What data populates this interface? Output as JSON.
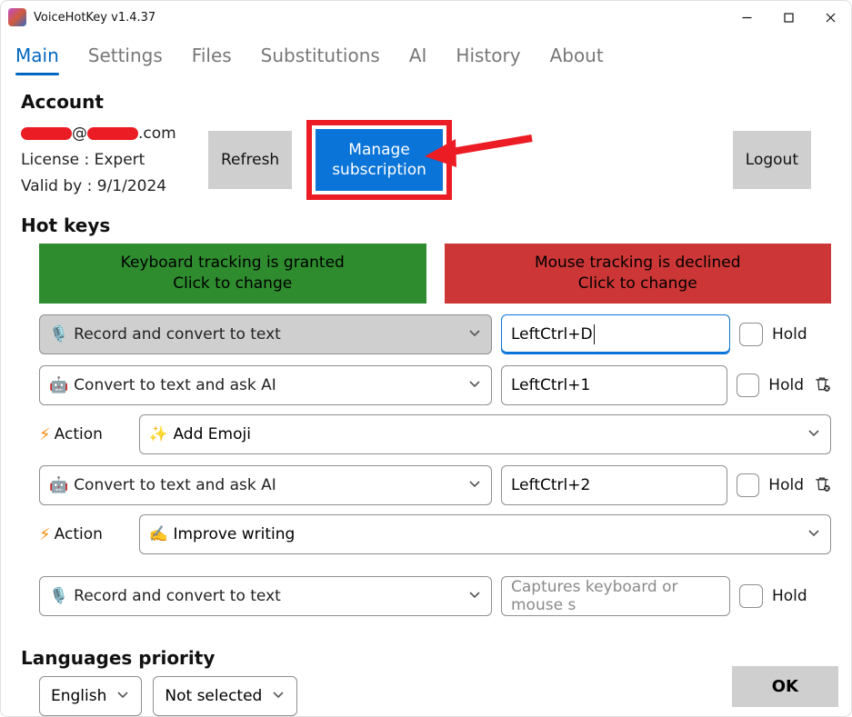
{
  "window": {
    "title": "VoiceHotKey v1.4.37"
  },
  "tabs": [
    {
      "label": "Main",
      "active": true
    },
    {
      "label": "Settings",
      "active": false
    },
    {
      "label": "Files",
      "active": false
    },
    {
      "label": "Substitutions",
      "active": false
    },
    {
      "label": "AI",
      "active": false
    },
    {
      "label": "History",
      "active": false
    },
    {
      "label": "About",
      "active": false
    }
  ],
  "account": {
    "section_title": "Account",
    "email_visible_suffix": ".com",
    "email_at": "@",
    "license_label": "License : Expert",
    "valid_label": "Valid by : 9/1/2024",
    "refresh_label": "Refresh",
    "manage_label_line1": "Manage",
    "manage_label_line2": "subscription",
    "logout_label": "Logout"
  },
  "hotkeys": {
    "section_title": "Hot keys",
    "keyboard_bar_line1": "Keyboard tracking is granted",
    "keyboard_bar_line2": "Click to change",
    "mouse_bar_line1": "Mouse tracking is declined",
    "mouse_bar_line2": "Click to change",
    "rows": [
      {
        "mode_icon": "🎙️",
        "mode_label": "Record and convert to text",
        "mode_grey": true,
        "key_value": "LeftCtrl+D",
        "key_focused": true,
        "hold_label": "Hold",
        "has_delete": false,
        "action": null
      },
      {
        "mode_icon": "🤖",
        "mode_label": "Convert to text and ask AI",
        "mode_grey": false,
        "key_value": "LeftCtrl+1",
        "key_focused": false,
        "hold_label": "Hold",
        "has_delete": true,
        "action": {
          "icon": "✨",
          "label": "Add Emoji"
        }
      },
      {
        "mode_icon": "🤖",
        "mode_label": "Convert to text and ask AI",
        "mode_grey": false,
        "key_value": "LeftCtrl+2",
        "key_focused": false,
        "hold_label": "Hold",
        "has_delete": true,
        "action": {
          "icon": "✍️",
          "label": "Improve writing"
        }
      },
      {
        "mode_icon": "🎙️",
        "mode_label": "Record and convert to text",
        "mode_grey": false,
        "key_value": "",
        "key_placeholder": "Captures keyboard or mouse s",
        "key_focused": false,
        "hold_label": "Hold",
        "has_delete": false,
        "action": null
      }
    ],
    "action_word": "Action"
  },
  "languages": {
    "section_title": "Languages priority",
    "primary": "English",
    "secondary": "Not selected"
  },
  "footer": {
    "ok_label": "OK"
  }
}
